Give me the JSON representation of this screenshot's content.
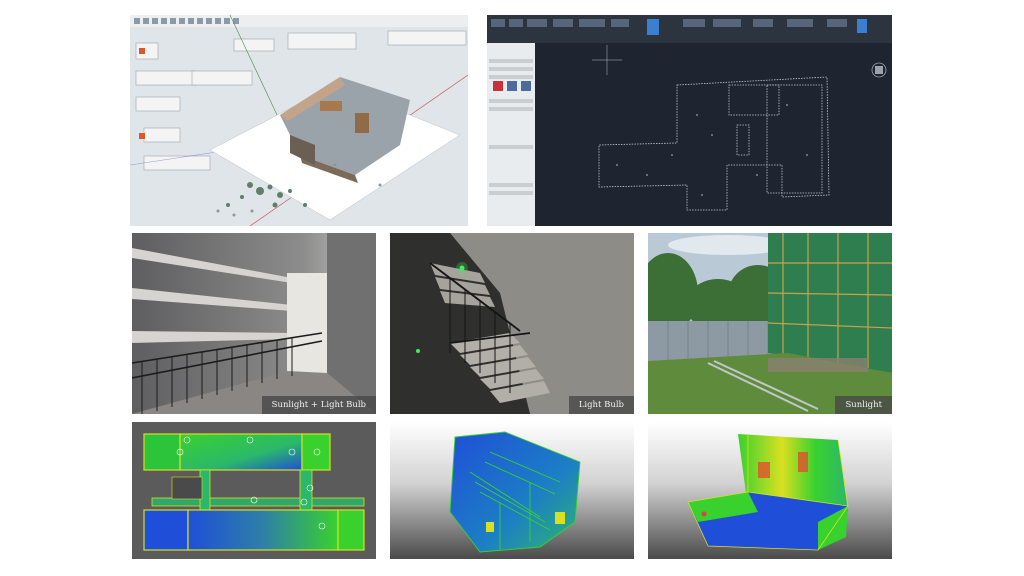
{
  "figure": {
    "row_top": {
      "left_panel": {
        "kind": "3d-model-software-screenshot"
      },
      "right_panel": {
        "kind": "cad-point-cloud-floorplan-screenshot"
      }
    },
    "row_photos": [
      {
        "caption": "Sunlight + Light Bulb"
      },
      {
        "caption": "Light Bulb"
      },
      {
        "caption": "Sunlight"
      }
    ],
    "row_clouds": [
      {
        "kind": "floorplan-point-cloud"
      },
      {
        "kind": "stairwell-point-cloud"
      },
      {
        "kind": "site-point-cloud"
      }
    ]
  },
  "colors": {
    "cloud_blue": "#1f4fd8",
    "cloud_green": "#39d12e",
    "cloud_yellow": "#d9e021",
    "cad_bg": "#1e2530",
    "caption_bg": "#464646"
  }
}
